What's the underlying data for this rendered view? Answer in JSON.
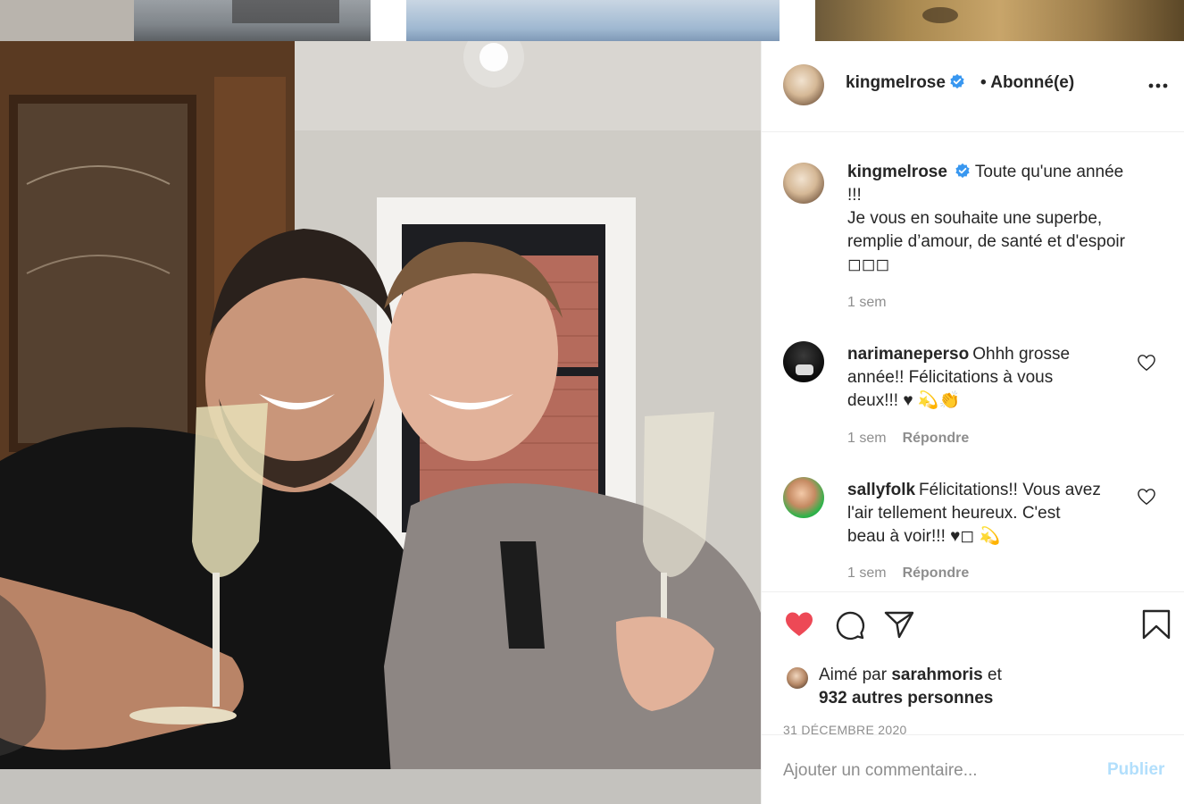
{
  "post": {
    "author": "kingmelrose",
    "follow_status": "• Abonné(e)",
    "caption_line1": "Toute qu'une année",
    "caption_line2": "!!!",
    "caption_line3": "Je vous en souhaite une superbe,",
    "caption_line4": "remplie d’amour, de santé et d'espoir",
    "caption_line5": "◻◻◻",
    "caption_time": "1 sem",
    "liked_prefix": "Aimé par",
    "liked_by": "sarahmoris",
    "liked_conj": "et",
    "liked_others": "932 autres personnes",
    "date": "31 DÉCEMBRE 2020"
  },
  "comments": [
    {
      "user": "narimaneperso",
      "text_line1": "Ohhh grosse",
      "text_line2": "année!! Félicitations à vous",
      "text_line3": "deux!!! ♥ 💫👏",
      "time": "1 sem",
      "reply": "Répondre"
    },
    {
      "user": "sallyfolk",
      "text_line1": "Félicitations!! Vous avez",
      "text_line2": "l'air tellement heureux. C'est",
      "text_line3": "beau à voir!!! ♥◻ 💫",
      "time": "1 sem",
      "reply": "Répondre"
    }
  ],
  "add_comment": {
    "placeholder": "Ajouter un commentaire...",
    "publish_label": "Publier"
  },
  "icons": {
    "verified": "verified-badge-icon",
    "more": "more-options-icon",
    "like": "heart-filled-icon",
    "comment": "comment-bubble-icon",
    "share": "paper-plane-icon",
    "save": "bookmark-icon"
  },
  "colors": {
    "like_red": "#ed4956",
    "verified_blue": "#3897f0",
    "publish_disabled": "#b2dffc",
    "muted_text": "#8e8e8e"
  }
}
